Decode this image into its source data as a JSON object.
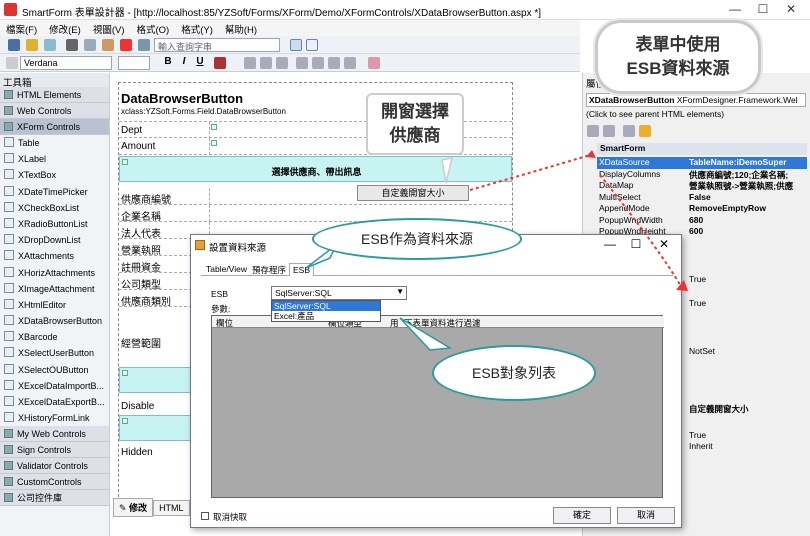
{
  "window": {
    "title": "SmartForm 表單設計器 - [http://localhost:85/YZSoft/Forms/XForm/Demo/XFormControls/XDataBrowserButton.aspx *]"
  },
  "menu": [
    "檔案(F)",
    "修改(E)",
    "視圖(V)",
    "格式(O)",
    "格式(Y)",
    "幫助(H)"
  ],
  "toolbar": {
    "search_placeholder": "輸入查詢字串",
    "font": "Verdana"
  },
  "toolbox": {
    "title": "工具箱",
    "categories_top": [
      "HTML Elements",
      "Web Controls",
      "XForm Controls"
    ],
    "items": [
      "Table",
      "XLabel",
      "XTextBox",
      "XDateTimePicker",
      "XCheckBoxList",
      "XRadioButtonList",
      "XDropDownList",
      "XAttachments",
      "XHorizAttachments",
      "XImageAttachment",
      "XHtmlEditor",
      "XDataBrowserButton",
      "XBarcode",
      "XSelectUserButton",
      "XSelectOUButton",
      "XExcelDataImportB...",
      "XExcelDataExportB...",
      "XHistoryFormLink"
    ],
    "categories_bottom": [
      "My Web Controls",
      "Sign Controls",
      "Validator Controls",
      "CustomControls",
      "公司控件庫"
    ]
  },
  "form": {
    "title": "DataBrowserButton",
    "subtitle": "xclass:YZSoft.Forms.Field.DataBrowserButton",
    "rows_top": [
      "Dept",
      "Amount"
    ],
    "header_band": "選擇供應商、帶出訊息",
    "rows": [
      "供應商編號",
      "企業名稱",
      "法人代表",
      "營業執照",
      "註冊資金",
      "公司類型",
      "供應商類別"
    ],
    "scope": "經營範圍",
    "disable": "Disable",
    "hidden": "Hidden",
    "button_text": "自定義開窗大小"
  },
  "designer_tabs": [
    "修改",
    "HTML"
  ],
  "properties": {
    "title": "屬性",
    "object": "XDataBrowserButton",
    "object_type": "XFormDesigner.Framework.Wel",
    "parent_hint": "(Click to see parent HTML elements)",
    "group": "SmartForm",
    "rows": [
      {
        "name": "XDataSource",
        "value": "TableName:iDemoSuper"
      },
      {
        "name": "DisplayColumns",
        "value": "供應商編號;120;企業名稱;"
      },
      {
        "name": "DataMap",
        "value": "營業執照號->營業執照;供應"
      },
      {
        "name": "MultiSelect",
        "value": "False"
      },
      {
        "name": "AppendMode",
        "value": "RemoveEmptyRow"
      },
      {
        "name": "PopupWndWidth",
        "value": "680"
      },
      {
        "name": "PopupWndHeight",
        "value": "600"
      }
    ],
    "lower_values": [
      "True",
      "True",
      "NotSet",
      "自定義開窗大小",
      "True",
      "Inherit"
    ]
  },
  "dialog": {
    "title": "設置資料來源",
    "tabs": [
      "Table/View",
      "預存程序",
      "ESB"
    ],
    "esb_label": "ESB",
    "esb_value": "SqlServer:SQL",
    "options": [
      "SqlServer:SQL",
      "Excel:產品"
    ],
    "params_label": "參數:",
    "grid_headers": [
      "欄位",
      "欄位類型",
      "用",
      "下表單資料進行過濾"
    ],
    "cancel_cache": "取消快取",
    "ok": "確定",
    "cancel": "取消"
  },
  "callouts": {
    "cloud": [
      "表單中使用",
      "ESB資料來源"
    ],
    "popup": [
      "開窗選擇",
      "供應商"
    ],
    "esb_source": "ESB作為資料來源",
    "esb_list": "ESB對象列表"
  }
}
